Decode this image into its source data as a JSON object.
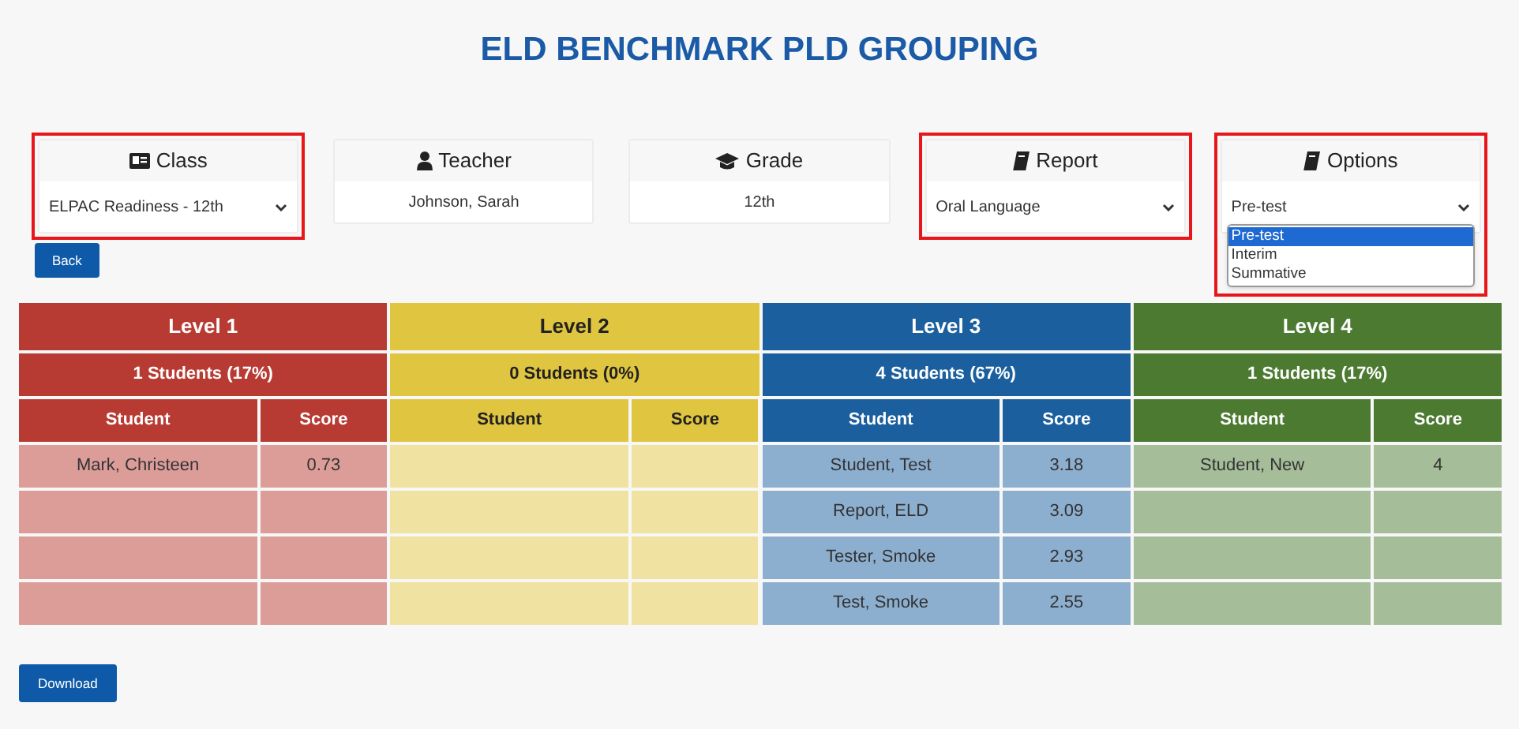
{
  "title": "ELD BENCHMARK PLD GROUPING",
  "cards": [
    {
      "kind": "select",
      "label": "Class",
      "value": "ELPAC Readiness - 12th",
      "highlighted": true
    },
    {
      "kind": "text",
      "label": "Teacher",
      "value": "Johnson, Sarah",
      "highlighted": false
    },
    {
      "kind": "text",
      "label": "Grade",
      "value": "12th",
      "highlighted": false
    },
    {
      "kind": "select",
      "label": "Report",
      "value": "Oral Language",
      "highlighted": true
    },
    {
      "kind": "select",
      "label": "Options",
      "value": "Pre-test",
      "highlighted": true,
      "expanded": true,
      "options": [
        {
          "label": "Pre-test",
          "selected": true
        },
        {
          "label": "Interim",
          "selected": false
        },
        {
          "label": "Summative",
          "selected": false
        }
      ]
    }
  ],
  "back_button": "Back",
  "levels": [
    {
      "label": "Level 1",
      "count": "1 Students (17%)",
      "color": "#b83b33",
      "columns": [
        "Student",
        "Score"
      ],
      "rows": [
        {
          "student": "Mark, Christeen",
          "score": "0.73"
        }
      ]
    },
    {
      "label": "Level 2",
      "count": "0 Students (0%)",
      "color": "#e0c540",
      "columns": [
        "Student",
        "Score"
      ]
    },
    {
      "label": "Level 3",
      "count": "4 Students (67%)",
      "color": "#1b5f9e",
      "columns": [
        "Student",
        "Score"
      ],
      "rows": [
        {
          "student": "Student, Test",
          "score": "3.18"
        },
        {
          "student": "Report, ELD",
          "score": "3.09"
        },
        {
          "student": "Tester, Smoke",
          "score": "2.93"
        },
        {
          "student": "Test, Smoke",
          "score": "2.55"
        }
      ]
    },
    {
      "label": "Level 4",
      "count": "1 Students (17%)",
      "color": "#4b7a30",
      "columns": [
        "Student",
        "Score"
      ],
      "rows": [
        {
          "student": "Student, New",
          "score": "4"
        }
      ]
    }
  ],
  "download_button": "Download"
}
